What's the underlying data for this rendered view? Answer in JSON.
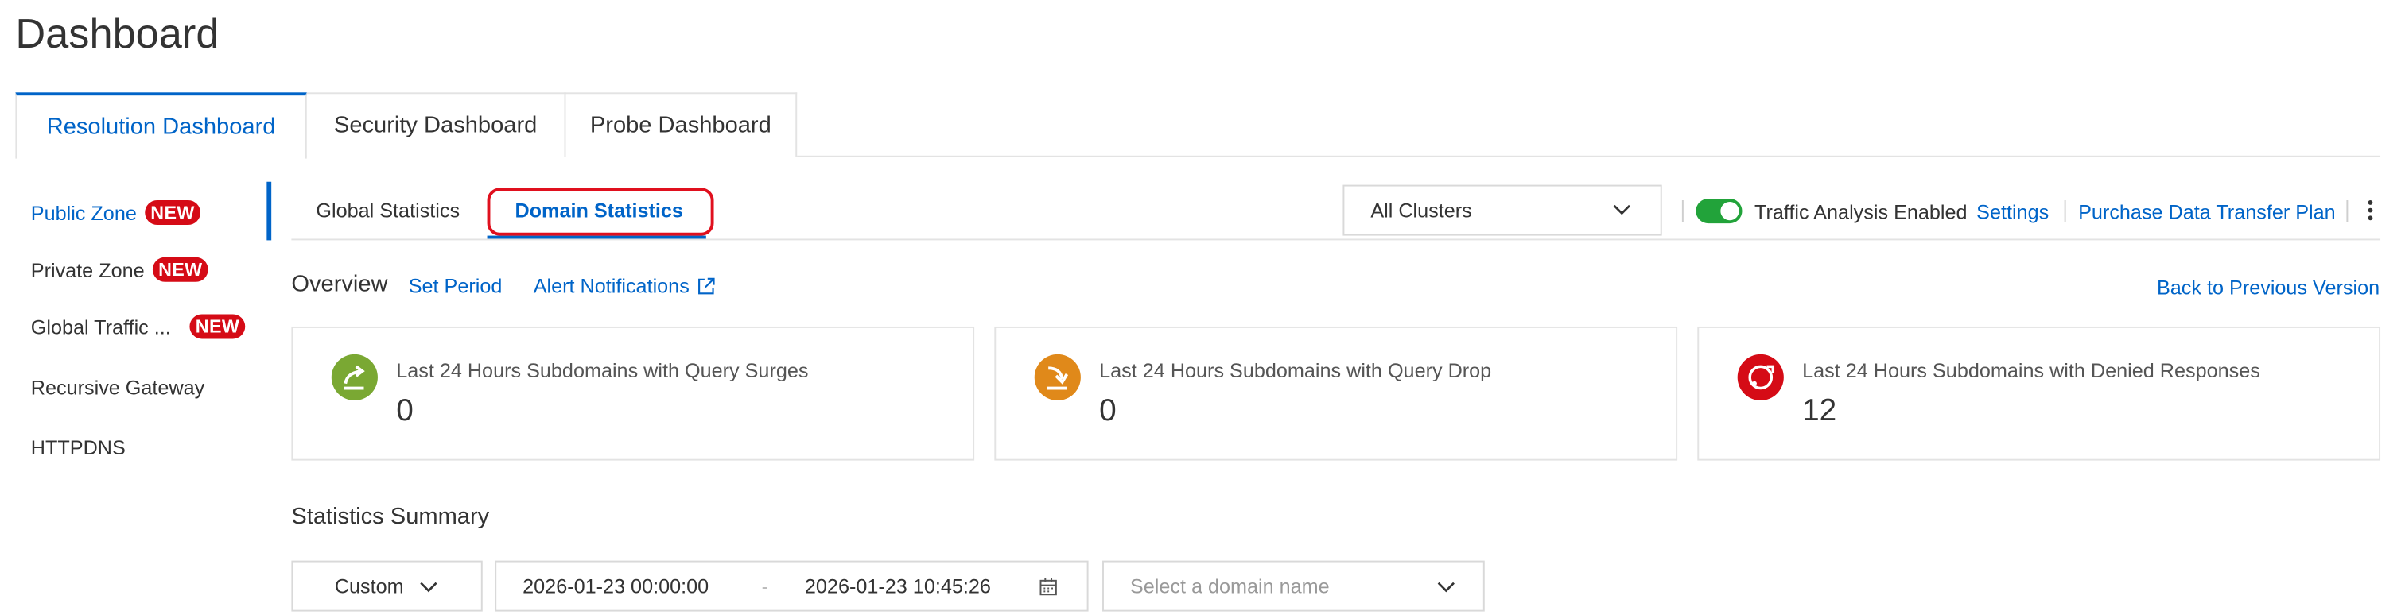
{
  "page": {
    "title": "Dashboard"
  },
  "top_tabs": [
    {
      "label": "Resolution Dashboard",
      "active": true
    },
    {
      "label": "Security Dashboard",
      "active": false
    },
    {
      "label": "Probe Dashboard",
      "active": false
    }
  ],
  "sidebar": {
    "badge": "NEW",
    "items": [
      {
        "label": "Public Zone",
        "active": true
      },
      {
        "label": "Private Zone"
      },
      {
        "label": "Global Traffic ..."
      },
      {
        "label": "Recursive Gateway"
      },
      {
        "label": "HTTPDNS"
      }
    ]
  },
  "sub_tabs": [
    {
      "label": "Global Statistics"
    },
    {
      "label": "Domain Statistics",
      "active": true
    }
  ],
  "toolbar": {
    "cluster_select": "All Clusters",
    "traffic_toggle_on": true,
    "traffic_label": "Traffic Analysis Enabled",
    "settings_link": "Settings",
    "purchase_link": "Purchase Data Transfer Plan"
  },
  "overview": {
    "title": "Overview",
    "set_period": "Set Period",
    "alert_notifications": "Alert Notifications",
    "back_link": "Back to Previous Version"
  },
  "cards": [
    {
      "label": "Last 24 Hours Subdomains with Query Surges",
      "value": "0",
      "icon": "query-surge-icon",
      "color": "#7aa833"
    },
    {
      "label": "Last 24 Hours Subdomains with Query Drop",
      "value": "0",
      "icon": "query-drop-icon",
      "color": "#e0891a"
    },
    {
      "label": "Last 24 Hours Subdomains with Denied Responses",
      "value": "12",
      "icon": "denied-response-icon",
      "color": "#d50b16"
    }
  ],
  "summary": {
    "title": "Statistics Summary",
    "period_select": "Custom",
    "start": "2026-01-23 00:00:00",
    "separator": "-",
    "end": "2026-01-23 10:45:26",
    "domain_placeholder": "Select a domain name"
  },
  "colors": {
    "accent": "#0064c8",
    "badge": "#d50b16",
    "toggle": "#22a33a",
    "highlight": "#e0101e"
  }
}
